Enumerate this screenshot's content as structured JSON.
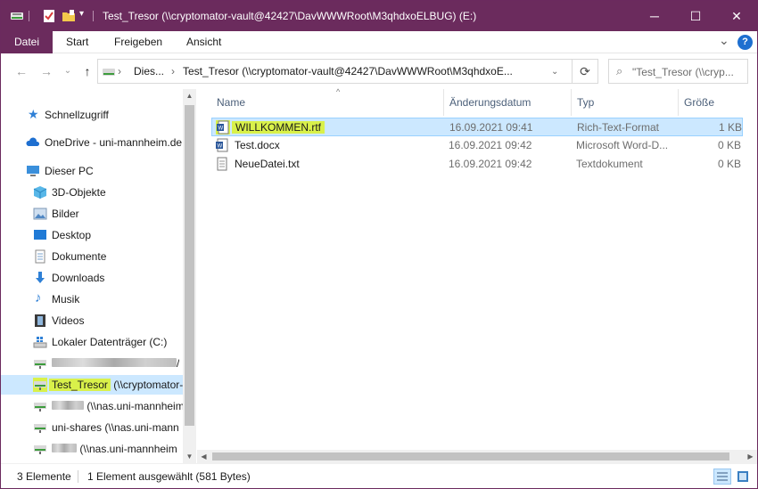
{
  "window": {
    "title": "Test_Tresor (\\\\cryptomator-vault@42427\\DavWWWRoot\\M3qhdxoELBUG) (E:)",
    "accent_color": "#6b2b5d",
    "controls": {
      "minimize": "─",
      "maximize": "☐",
      "close": "✕"
    }
  },
  "ribbon": {
    "tabs": [
      "Datei",
      "Start",
      "Freigeben",
      "Ansicht"
    ],
    "expand_glyph": "⌄",
    "help_glyph": "?"
  },
  "address": {
    "segments": [
      "Dies...",
      "Test_Tresor (\\\\cryptomator-vault@42427\\DavWWWRoot\\M3qhdxoE..."
    ],
    "search_placeholder": "\"Test_Tresor (\\\\cryp..."
  },
  "nav": {
    "quick_access": "Schnellzugriff",
    "onedrive": "OneDrive - uni-mannheim.de",
    "this_pc": "Dieser PC",
    "items": [
      "3D-Objekte",
      "Bilder",
      "Desktop",
      "Dokumente",
      "Downloads",
      "Musik",
      "Videos",
      "Lokaler Datenträger (C:)"
    ],
    "drives": {
      "d1_suffix": "/",
      "tresor_name": "Test_Tresor",
      "tresor_path": " (\\\\cryptomator-v",
      "d3_suffix": " (\\\\nas.uni-mannheim",
      "unishares": "uni-shares (\\\\nas.uni-mann",
      "d5_suffix": " (\\\\nas.uni-mannheim"
    }
  },
  "columns": {
    "name": "Name",
    "date": "Änderungsdatum",
    "type": "Typ",
    "size": "Größe",
    "sort_caret": "^"
  },
  "files": [
    {
      "name": "WILLKOMMEN.rtf",
      "date": "16.09.2021 09:41",
      "type": "Rich-Text-Format",
      "size": "1 KB"
    },
    {
      "name": "Test.docx",
      "date": "16.09.2021 09:42",
      "type": "Microsoft Word-D...",
      "size": "0 KB"
    },
    {
      "name": "NeueDatei.txt",
      "date": "16.09.2021 09:42",
      "type": "Textdokument",
      "size": "0 KB"
    }
  ],
  "status": {
    "count": "3 Elemente",
    "selection": "1 Element ausgewählt (581 Bytes)"
  }
}
